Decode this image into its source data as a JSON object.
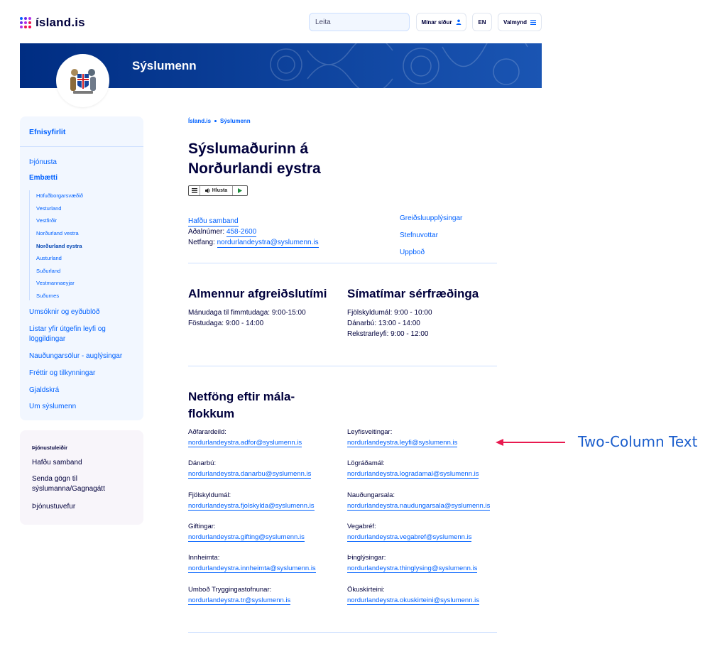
{
  "header": {
    "logo_text": "ísland.is",
    "search_placeholder": "Leita",
    "my_pages_label": "Mínar síður",
    "lang_label": "EN",
    "menu_label": "Valmynd"
  },
  "banner": {
    "title": "Sýslumenn"
  },
  "sidebar": {
    "heading": "Efnisyfirlit",
    "items_top": [
      "Þjónusta",
      "Embætti"
    ],
    "sub_items": [
      "Höfuðborgarsvæðið",
      "Vesturland",
      "Vestfirðir",
      "Norðurland vestra",
      "Norðurland eystra",
      "Austurland",
      "Suðurland",
      "Vestmannaeyjar",
      "Suðurnes"
    ],
    "active_sub": "Norðurland eystra",
    "items_bottom": [
      "Umsóknir og eyðublöð",
      "Listar yfir útgefin leyfi og löggildingar",
      "Nauðungarsölur - auglýsingar",
      "Fréttir og tilkynningar",
      "Gjaldskrá",
      "Um sýslumenn"
    ]
  },
  "service_box": {
    "heading": "Þjónustuleiðir",
    "items": [
      "Hafðu samband",
      "Senda gögn til sýslumanna/Gagnagátt",
      "Þjónustuvefur"
    ]
  },
  "breadcrumb": [
    "Ísland.is",
    "Sýslumenn"
  ],
  "page_title": "Sýslumaðurinn á Norðurlandi eystra",
  "player": {
    "listen_label": "Hlusta"
  },
  "contact": {
    "link": "Hafðu samband",
    "phone_label": "Aðalnúmer:",
    "phone": "458-2600",
    "email_label": "Netfang:",
    "email": "nordurlandeystra@syslumenn.is"
  },
  "quick_links": [
    "Greiðsluupplýsingar",
    "Stefnuvottar",
    "Uppboð"
  ],
  "hours_section": {
    "title": "Almennur afgreiðslutími",
    "lines": [
      "Mánudaga til fimmtudaga: 9:00-15:00",
      "Föstudaga: 9:00 - 14:00"
    ]
  },
  "phone_section": {
    "title": "Símatímar sérfræðinga",
    "lines": [
      "Fjölskyldumál: 9:00 - 10:00",
      "Dánarbú: 13:00 - 14:00",
      "Rekstrarleyfi: 9:00 - 12:00"
    ]
  },
  "emails_section": {
    "title": "Netföng eftir mála-flokkum",
    "left": [
      {
        "label": "Aðfarardeild:",
        "email": "nordurlandeystra.adfor@syslumenn.is"
      },
      {
        "label": "Dánarbú:",
        "email": "nordurlandeystra.danarbu@syslumenn.is"
      },
      {
        "label": "Fjölskyldumál:",
        "email": "nordurlandeystra.fjolskylda@syslumenn.is"
      },
      {
        "label": "Giftingar:",
        "email": "nordurlandeystra.gifting@syslumenn.is"
      },
      {
        "label": "Innheimta:",
        "email": "nordurlandeystra.innheimta@syslumenn.is"
      },
      {
        "label": "Umboð Tryggingastofnunar:",
        "email": "nordurlandeystra.tr@syslumenn.is"
      }
    ],
    "right": [
      {
        "label": "Leyfisveitingar:",
        "email": "nordurlandeystra.leyfi@syslumenn.is"
      },
      {
        "label": "Lögráðamál:",
        "email": "nordurlandeystra.logradamal@syslumenn.is"
      },
      {
        "label": "Nauðungarsala:",
        "email": "nordurlandeystra.naudungarsala@syslumenn.is"
      },
      {
        "label": "Vegabréf:",
        "email": "nordurlandeystra.vegabref@syslumenn.is"
      },
      {
        "label": "Þinglýsingar:",
        "email": "nordurlandeystra.thinglysing@syslumenn.is"
      },
      {
        "label": "Ökuskírteini:",
        "email": "nordurlandeystra.okuskirteini@syslumenn.is"
      }
    ]
  },
  "annotation": {
    "text": "Two-Column Text",
    "color": "#e8194f"
  },
  "colors": {
    "primary": "#0061ff",
    "dark": "#00003c",
    "banner": "#002d82"
  }
}
